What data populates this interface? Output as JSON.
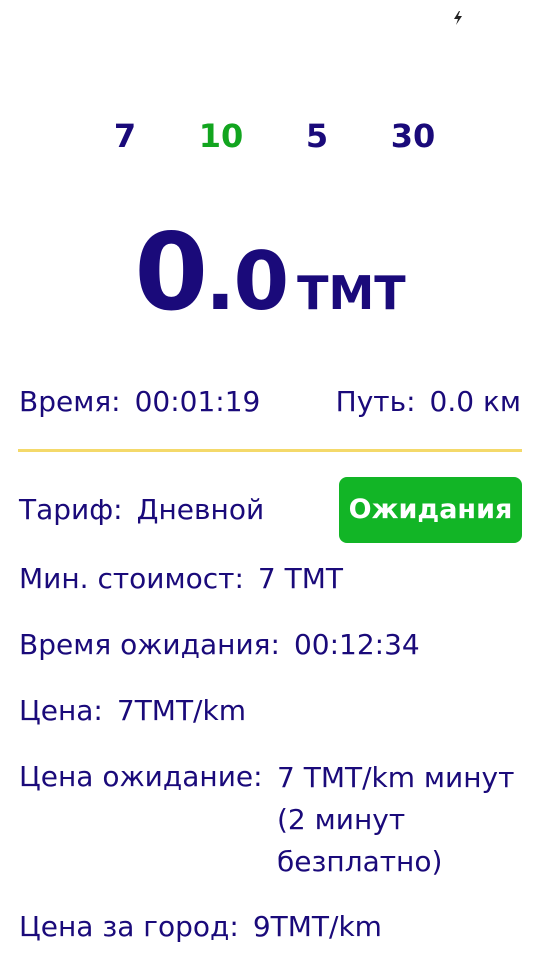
{
  "status_bar": {
    "icon": "lightning-bolt-icon"
  },
  "presets": [
    {
      "label": "7",
      "active": false
    },
    {
      "label": "10",
      "active": true
    },
    {
      "label": "5",
      "active": false
    },
    {
      "label": "30",
      "active": false
    }
  ],
  "fare": {
    "integer": "0",
    "decimal": ".0",
    "unit": "ТМТ"
  },
  "time": {
    "label": "Время:",
    "value": "00:01:19"
  },
  "distance": {
    "label": "Путь:",
    "value": "0.0 км"
  },
  "tariff": {
    "label": "Тариф:",
    "value": "Дневной"
  },
  "wait_button": {
    "label": "Ожидания"
  },
  "min_cost": {
    "label": "Мин. стоимост:",
    "value": "7 TMT"
  },
  "wait_time": {
    "label": "Время ожидания:",
    "value": "00:12:34"
  },
  "price": {
    "label": "Цена:",
    "value": "7TMT/km"
  },
  "wait_price": {
    "label": "Цена ожидание:",
    "value": "7 TMT/km минут (2 минут безплатно)"
  },
  "city_price": {
    "label": "Цена за город:",
    "value": "9TMT/km"
  },
  "colors": {
    "text": "#1a0a7a",
    "active": "#12a51f",
    "button": "#12b526",
    "divider": "#f4d96a"
  }
}
